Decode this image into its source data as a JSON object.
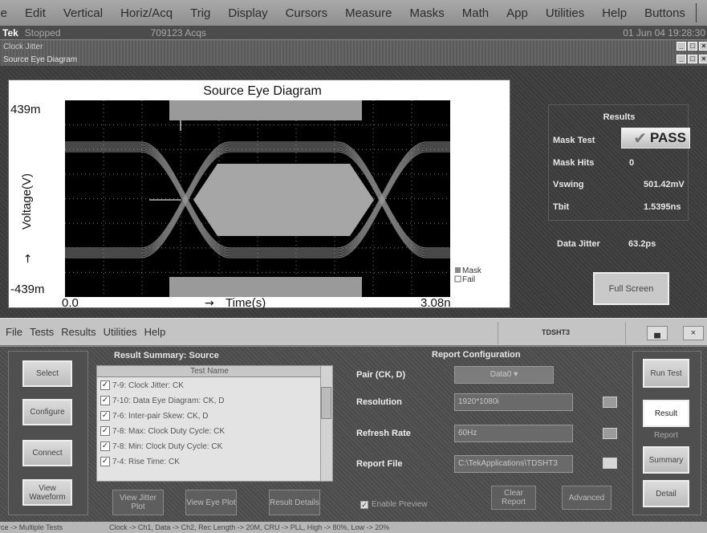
{
  "menubar": {
    "items": [
      "ile",
      "Edit",
      "Vertical",
      "Horiz/Acq",
      "Trig",
      "Display",
      "Cursors",
      "Measure",
      "Masks",
      "Math",
      "App",
      "Utilities",
      "Help",
      "Buttons"
    ]
  },
  "status": {
    "brand": "Tek",
    "state": "Stopped",
    "acqs": "709123 Acqs",
    "date": "01 Jun 04 19:28:30"
  },
  "windows": {
    "outer_title": "Clock Jitter",
    "inner_title": "Source Eye Diagram"
  },
  "chart_data": {
    "type": "eye-diagram",
    "title": "Source Eye Diagram",
    "xlabel": "Time(s)",
    "ylabel": "Voltage(V)",
    "x_min_label": "0.0",
    "x_max_label": "3.08n",
    "y_max_label": "439m",
    "y_min_label": "-439m",
    "xlim": [
      0,
      3.08
    ],
    "ylim": [
      -439,
      439
    ],
    "grid": true,
    "legend": [
      "Mask",
      "Fail"
    ],
    "legend_position": "bottom-right"
  },
  "results": {
    "title": "Results",
    "rows": [
      {
        "label": "Mask Test",
        "value": "PASS"
      },
      {
        "label": "Mask Hits",
        "value": "0"
      },
      {
        "label": "Vswing",
        "value": "501.42mV"
      },
      {
        "label": "Tbit",
        "value": "1.5395ns"
      }
    ],
    "data_jitter_label": "Data Jitter",
    "data_jitter_value": "63.2ps",
    "full_screen": "Full Screen"
  },
  "appmenu": {
    "items": [
      "File",
      "Tests",
      "Results",
      "Utilities",
      "Help"
    ],
    "product": "TDSHT3"
  },
  "left_buttons": [
    "Select",
    "Configure",
    "Connect",
    "View Waveform"
  ],
  "result_summary": {
    "title": "Result Summary: Source",
    "column": "Test Name",
    "tests": [
      "7-9: Clock Jitter: CK",
      "7-10: Data Eye Diagram: CK, D",
      "7-6: Inter-pair Skew: CK, D",
      "7-8: Max: Clock Duty Cycle: CK",
      "7-8: Min: Clock Duty Cycle: CK",
      "7-4: Rise Time: CK"
    ],
    "buttons": [
      "View Jitter Plot",
      "View Eye Plot",
      "Result Details"
    ]
  },
  "report": {
    "title": "Report Configuration",
    "pair_label": "Pair (CK, D)",
    "pair_value": "Data0",
    "resolution_label": "Resolution",
    "resolution_value": "1920*1080i",
    "refresh_label": "Refresh Rate",
    "refresh_value": "60Hz",
    "file_label": "Report File",
    "file_value": "C:\\TekApplications\\TDSHT3",
    "enable_preview": "Enable Preview",
    "clear_report": "Clear Report",
    "advanced": "Advanced"
  },
  "right_buttons": {
    "run": "Run Test",
    "result": "Result",
    "report_label": "Report",
    "summary": "Summary",
    "detail": "Detail"
  },
  "footer": {
    "mode": "rce -> Multiple Tests",
    "setup": "Clock -> Ch1, Data -> Ch2, Rec Length -> 20M, CRU -> PLL, High -> 80%, Low -> 20%"
  }
}
